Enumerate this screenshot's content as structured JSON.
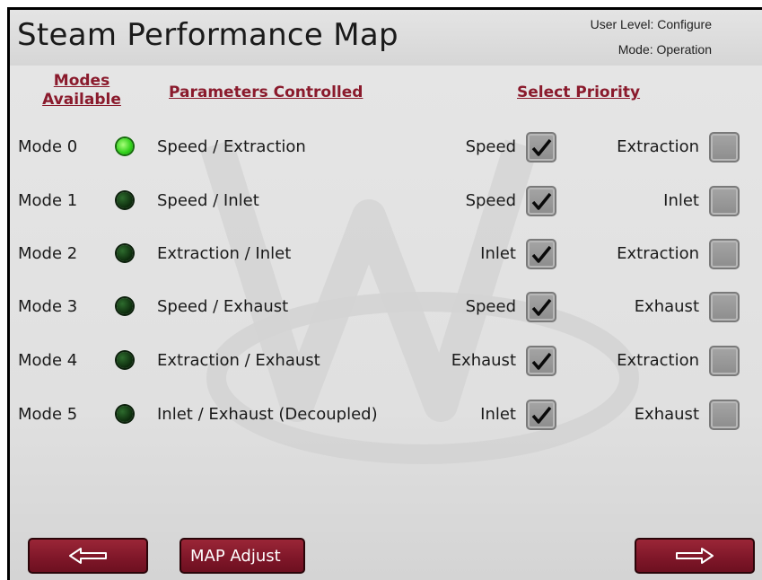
{
  "header": {
    "title": "Steam Performance Map",
    "user_level": "User Level: Configure",
    "mode": "Mode: Operation"
  },
  "columns": {
    "modes_available": "Modes Available",
    "parameters_controlled": "Parameters Controlled",
    "select_priority": "Select Priority"
  },
  "rows": [
    {
      "mode": "Mode 0",
      "active": true,
      "parameters": "Speed / Extraction",
      "priority_1": "Speed",
      "priority_1_checked": true,
      "priority_2": "Extraction",
      "priority_2_checked": false
    },
    {
      "mode": "Mode 1",
      "active": false,
      "parameters": "Speed / Inlet",
      "priority_1": "Speed",
      "priority_1_checked": true,
      "priority_2": "Inlet",
      "priority_2_checked": false
    },
    {
      "mode": "Mode 2",
      "active": false,
      "parameters": "Extraction / Inlet",
      "priority_1": "Inlet",
      "priority_1_checked": true,
      "priority_2": "Extraction",
      "priority_2_checked": false
    },
    {
      "mode": "Mode 3",
      "active": false,
      "parameters": "Speed / Exhaust",
      "priority_1": "Speed",
      "priority_1_checked": true,
      "priority_2": "Exhaust",
      "priority_2_checked": false
    },
    {
      "mode": "Mode 4",
      "active": false,
      "parameters": "Extraction / Exhaust",
      "priority_1": "Exhaust",
      "priority_1_checked": true,
      "priority_2": "Extraction",
      "priority_2_checked": false
    },
    {
      "mode": "Mode 5",
      "active": false,
      "parameters": "Inlet / Exhaust (Decoupled)",
      "priority_1": "Inlet",
      "priority_1_checked": true,
      "priority_2": "Exhaust",
      "priority_2_checked": false
    }
  ],
  "footer": {
    "back_icon": "left-arrow-icon",
    "map_adjust_label": "MAP Adjust",
    "next_icon": "right-arrow-icon"
  },
  "colors": {
    "accent": "#8a1a2c",
    "led_on": "#2ecf18",
    "led_off": "#0c2a0c",
    "button": "#7e1628"
  }
}
